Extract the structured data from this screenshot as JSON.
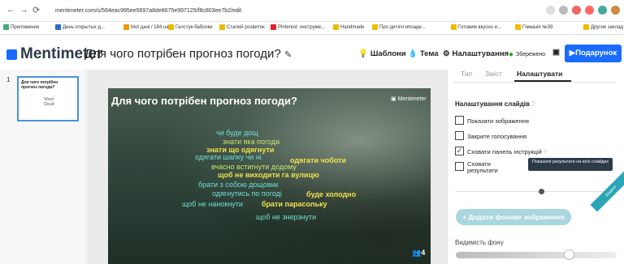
{
  "browser": {
    "url": "mentimeter.com/s/564eac995ee5697a8de8675e997125/f8c803ee7b2/edit",
    "bookmarks": [
      "Приложения",
      "День открытых д...",
      "Мої дані / 184 ua",
      "Галстук-бабочки",
      "Сталий розвиток",
      "Pinterest: инструме...",
      "Handmade",
      "Про дитячі ипоаде...",
      "Готовим вкусно и...",
      "Гімназія №39",
      "Другие заклад"
    ]
  },
  "header": {
    "logo": "Mentimeter",
    "title": "Для чого потрібен прогноз погоди?",
    "templates": "Шаблони",
    "theme": "Тема",
    "settings": "Налаштування",
    "saved": "Збережено",
    "present": "Подарунок"
  },
  "rail": {
    "slide_number": "1",
    "thumb_title": "Для чого потрібен прогноз погоди?",
    "thumb_label": "Word Cloud"
  },
  "slide": {
    "title": "Для чого потрібен прогноз погоди?",
    "brand": "Mentimeter",
    "votes": "4",
    "words": [
      "чи буде дощ",
      "знати яка погода",
      "знати що одягнути",
      "одягати шапку чи ні",
      "одягати чоботи",
      "вчасно встигнути додому",
      "щоб не виходити га вулицю",
      "брати з собою дощовик",
      "одягнутись по погоді",
      "буде холодно",
      "щоб не нанокнути",
      "брати парасольку",
      "щоб не знерзнути"
    ]
  },
  "panel": {
    "tabs": [
      "Тип",
      "Зміст",
      "Налаштувати"
    ],
    "section_title": "Налаштування слайдів",
    "options": [
      "Показати зображення",
      "Закрите голосування",
      "Сховати панель інструкцій",
      "Сховати результати"
    ],
    "show_results_button": "Показати результати на всіх слайдах",
    "add_bg_button": "Додати фонове зображення",
    "ribbon": "Додати",
    "visibility_label": "Видимість фону"
  },
  "colors": {
    "brand": "#196cff",
    "header_text": "#2d3a4a",
    "accent_teal": "#a9d6df"
  }
}
